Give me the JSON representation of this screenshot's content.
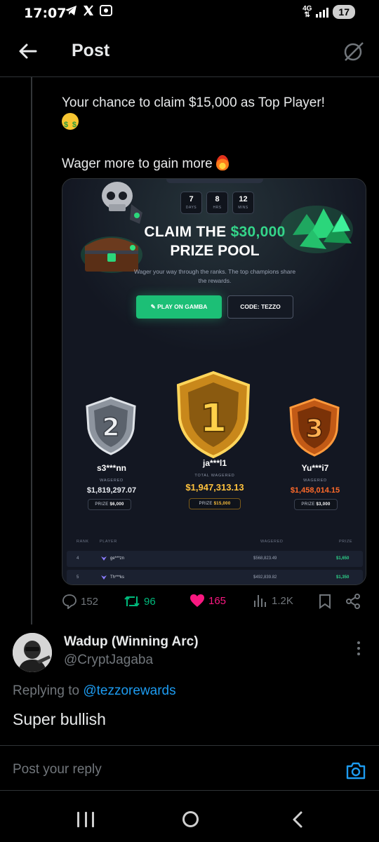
{
  "status_bar": {
    "time": "17:07",
    "network": "4G",
    "battery": "17"
  },
  "header": {
    "title": "Post"
  },
  "tweet": {
    "line1": "Your chance to claim $15,000 as Top Player!",
    "line2": "Wager more to gain more"
  },
  "media": {
    "timer": [
      {
        "value": "7",
        "label": "DAYS"
      },
      {
        "value": "8",
        "label": "HRS"
      },
      {
        "value": "12",
        "label": "MINS"
      }
    ],
    "claim_prefix": "CLAIM THE ",
    "claim_amount": "$30,000",
    "claim_line2": "PRIZE POOL",
    "subtitle": "Wager your way through the ranks. The top champions share the rewards.",
    "play_button": "PLAY ON GAMBA",
    "code_button": "CODE: TEZZO",
    "podium": {
      "first": {
        "name": "ja***l1",
        "label": "TOTAL WAGERED",
        "amount": "$1,947,313.13",
        "prize_label": "PRIZE",
        "prize": "$15,000"
      },
      "second": {
        "name": "s3***nn",
        "label": "WAGERED",
        "amount": "$1,819,297.07",
        "prize_label": "PRIZE",
        "prize": "$6,000"
      },
      "third": {
        "name": "Yu***i7",
        "label": "WAGERED",
        "amount": "$1,458,014.15",
        "prize_label": "PRIZE",
        "prize": "$3,000"
      }
    },
    "table": {
      "columns": [
        "RANK",
        "PLAYER",
        "WAGERED",
        "PRIZE"
      ],
      "rows": [
        {
          "rank": "4",
          "player": "ge***zn",
          "wagered": "$568,823.49",
          "prize": "$1,650"
        },
        {
          "rank": "5",
          "player": "Th***ks",
          "wagered": "$492,839.82",
          "prize": "$1,350"
        }
      ]
    }
  },
  "actions": {
    "replies": "152",
    "reposts": "96",
    "likes": "165",
    "views": "1.2K"
  },
  "reply": {
    "name": "Wadup (Winning Arc)",
    "handle": "@CryptJagaba",
    "replying_prefix": "Replying to ",
    "replying_to": "@tezzorewards",
    "text": "Super bullish"
  },
  "composer": {
    "placeholder": "Post your reply"
  },
  "colors": {
    "accent_blue": "#1d9bf0",
    "like_pink": "#f91880",
    "repost_green": "#00ba7c",
    "prize_green": "#1cbf76",
    "gold": "#ffc23d",
    "orange": "#ff6a2a"
  }
}
